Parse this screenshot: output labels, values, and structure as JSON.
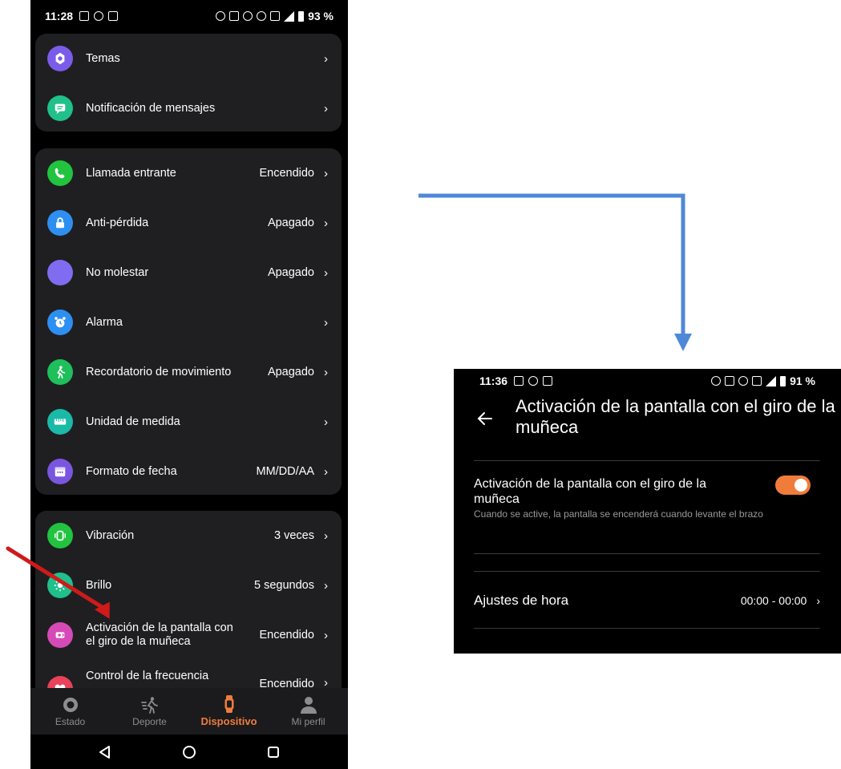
{
  "left_phone": {
    "status": {
      "time": "11:28",
      "battery": "93 %"
    },
    "card1": [
      {
        "label": "Temas",
        "value": "",
        "icon": "theme-icon",
        "color": "#7b5ce8"
      },
      {
        "label": "Notificación de mensajes",
        "value": "",
        "icon": "message-icon",
        "color": "#20c08a"
      }
    ],
    "card2": [
      {
        "label": "Llamada entrante",
        "value": "Encendido",
        "icon": "phone-icon",
        "color": "#21c33f"
      },
      {
        "label": "Anti-pérdida",
        "value": "Apagado",
        "icon": "lock-icon",
        "color": "#2e8ff0"
      },
      {
        "label": "No molestar",
        "value": "Apagado",
        "icon": "moon-icon",
        "color": "#7f6cf0"
      },
      {
        "label": "Alarma",
        "value": "",
        "icon": "alarm-icon",
        "color": "#2d8ff2"
      },
      {
        "label": "Recordatorio de movimiento",
        "value": "Apagado",
        "icon": "walk-icon",
        "color": "#1fbf5b"
      },
      {
        "label": "Unidad de medida",
        "value": "",
        "icon": "ruler-icon",
        "color": "#1bb9a7"
      },
      {
        "label": "Formato de fecha",
        "value": "MM/DD/AA",
        "icon": "calendar-icon",
        "color": "#7a56e0"
      }
    ],
    "card3": [
      {
        "label": "Vibración",
        "value": "3 veces",
        "icon": "vibration-icon",
        "color": "#21c33f"
      },
      {
        "label": "Brillo",
        "value": "5 segundos",
        "icon": "brightness-icon",
        "color": "#1fc08b"
      },
      {
        "label": "Activación de la pantalla con el giro de la muñeca",
        "value": "Encendido",
        "icon": "wrist-icon",
        "color": "#d64ab8"
      },
      {
        "label": "Control de la frecuencia",
        "value": "Encendido",
        "icon": "heart-icon",
        "color": "#e8435a"
      }
    ],
    "nav": [
      {
        "label": "Estado",
        "icon": "status-icon"
      },
      {
        "label": "Deporte",
        "icon": "sport-icon"
      },
      {
        "label": "Dispositivo",
        "icon": "device-icon"
      },
      {
        "label": "Mi perfil",
        "icon": "profile-icon"
      }
    ]
  },
  "right_phone": {
    "status": {
      "time": "11:36",
      "battery": "91 %"
    },
    "title": "Activación de la pantalla con el giro de la muñeca",
    "setting": {
      "title": "Activación de la pantalla con el giro de la muñeca",
      "subtitle": "Cuando se active, la pantalla se encenderá cuando levante el brazo",
      "enabled": true
    },
    "time_row": {
      "label": "Ajustes de hora",
      "value": "00:00 - 00:00"
    }
  },
  "colors": {
    "accent": "#f07c3c",
    "connector_arrow": "#4f88d8",
    "highlight_arrow": "#d01a1a",
    "card_bg": "#1f1f21"
  }
}
